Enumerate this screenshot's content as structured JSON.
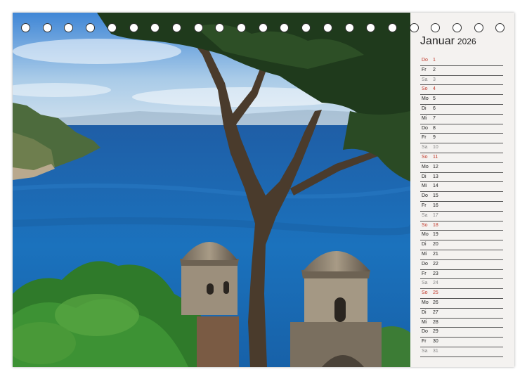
{
  "calendar": {
    "month": "Januar",
    "year": "2026",
    "days": [
      {
        "wd": "Do",
        "num": "1",
        "kind": "sun"
      },
      {
        "wd": "Fr",
        "num": "2",
        "kind": "week"
      },
      {
        "wd": "Sa",
        "num": "3",
        "kind": "sat"
      },
      {
        "wd": "So",
        "num": "4",
        "kind": "sun"
      },
      {
        "wd": "Mo",
        "num": "5",
        "kind": "week"
      },
      {
        "wd": "Di",
        "num": "6",
        "kind": "week"
      },
      {
        "wd": "Mi",
        "num": "7",
        "kind": "week"
      },
      {
        "wd": "Do",
        "num": "8",
        "kind": "week"
      },
      {
        "wd": "Fr",
        "num": "9",
        "kind": "week"
      },
      {
        "wd": "Sa",
        "num": "10",
        "kind": "sat"
      },
      {
        "wd": "So",
        "num": "11",
        "kind": "sun"
      },
      {
        "wd": "Mo",
        "num": "12",
        "kind": "week"
      },
      {
        "wd": "Di",
        "num": "13",
        "kind": "week"
      },
      {
        "wd": "Mi",
        "num": "14",
        "kind": "week"
      },
      {
        "wd": "Do",
        "num": "15",
        "kind": "week"
      },
      {
        "wd": "Fr",
        "num": "16",
        "kind": "week"
      },
      {
        "wd": "Sa",
        "num": "17",
        "kind": "sat"
      },
      {
        "wd": "So",
        "num": "18",
        "kind": "sun"
      },
      {
        "wd": "Mo",
        "num": "19",
        "kind": "week"
      },
      {
        "wd": "Di",
        "num": "20",
        "kind": "week"
      },
      {
        "wd": "Mi",
        "num": "21",
        "kind": "week"
      },
      {
        "wd": "Do",
        "num": "22",
        "kind": "week"
      },
      {
        "wd": "Fr",
        "num": "23",
        "kind": "week"
      },
      {
        "wd": "Sa",
        "num": "24",
        "kind": "sat"
      },
      {
        "wd": "So",
        "num": "25",
        "kind": "sun"
      },
      {
        "wd": "Mo",
        "num": "26",
        "kind": "week"
      },
      {
        "wd": "Di",
        "num": "27",
        "kind": "week"
      },
      {
        "wd": "Mi",
        "num": "28",
        "kind": "week"
      },
      {
        "wd": "Do",
        "num": "29",
        "kind": "week"
      },
      {
        "wd": "Fr",
        "num": "30",
        "kind": "week"
      },
      {
        "wd": "Sa",
        "num": "31",
        "kind": "sat"
      }
    ]
  },
  "colors": {
    "sunday": "#c0392b",
    "saturday": "#888888",
    "weekday": "#222222",
    "sea": "#1c6fb3",
    "sky": "#8dbde6"
  }
}
